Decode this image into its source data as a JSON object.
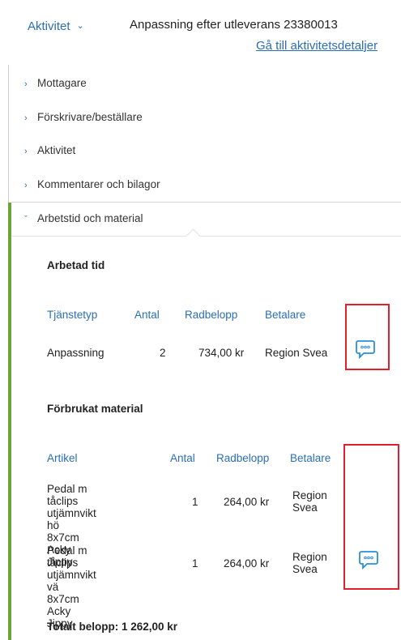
{
  "header": {
    "activity_dropdown": "Aktivitet",
    "title": "Anpassning efter utleverans  23380013",
    "details_link": "Gå till aktivitetsdetaljer"
  },
  "accordion": {
    "items": [
      {
        "label": "Mottagare"
      },
      {
        "label": "Förskrivare/beställare"
      },
      {
        "label": "Aktivitet"
      },
      {
        "label": "Kommentarer och bilagor"
      },
      {
        "label": "Arbetstid och material"
      }
    ]
  },
  "work_time": {
    "heading": "Arbetad tid",
    "columns": [
      "Tjänstetyp",
      "Antal",
      "Radbelopp",
      "Betalare"
    ],
    "rows": [
      {
        "service_type": "Anpassning",
        "count": "2",
        "amount": "734,00 kr",
        "payer": "Region Svea"
      }
    ]
  },
  "material": {
    "heading": "Förbrukat material",
    "columns": [
      "Artikel",
      "Antal",
      "Radbelopp",
      "Betalare"
    ],
    "rows": [
      {
        "article_l1": "Pedal m tåclips",
        "article_l2": "utjämnvikt hö",
        "article_l3": "8x7cm Acky Jippy",
        "count": "1",
        "amount": "264,00 kr",
        "payer_l1": "Region",
        "payer_l2": "Svea"
      },
      {
        "article_l1": "Pedal m tåclips",
        "article_l2": "utjämnvikt vä",
        "article_l3": "8x7cm Acky Jippy",
        "count": "1",
        "amount": "264,00 kr",
        "payer_l1": "Region",
        "payer_l2": "Svea"
      }
    ]
  },
  "total": "Totalt belopp: 1 262,00 kr",
  "colors": {
    "accent": "#2a6fb5",
    "active_bar": "#6aa53a",
    "highlight": "#e0202a"
  },
  "icons": {
    "comment": "speech-bubble-icon",
    "chevron": "chevron-down-icon",
    "arrow": "chevron-right-icon"
  }
}
